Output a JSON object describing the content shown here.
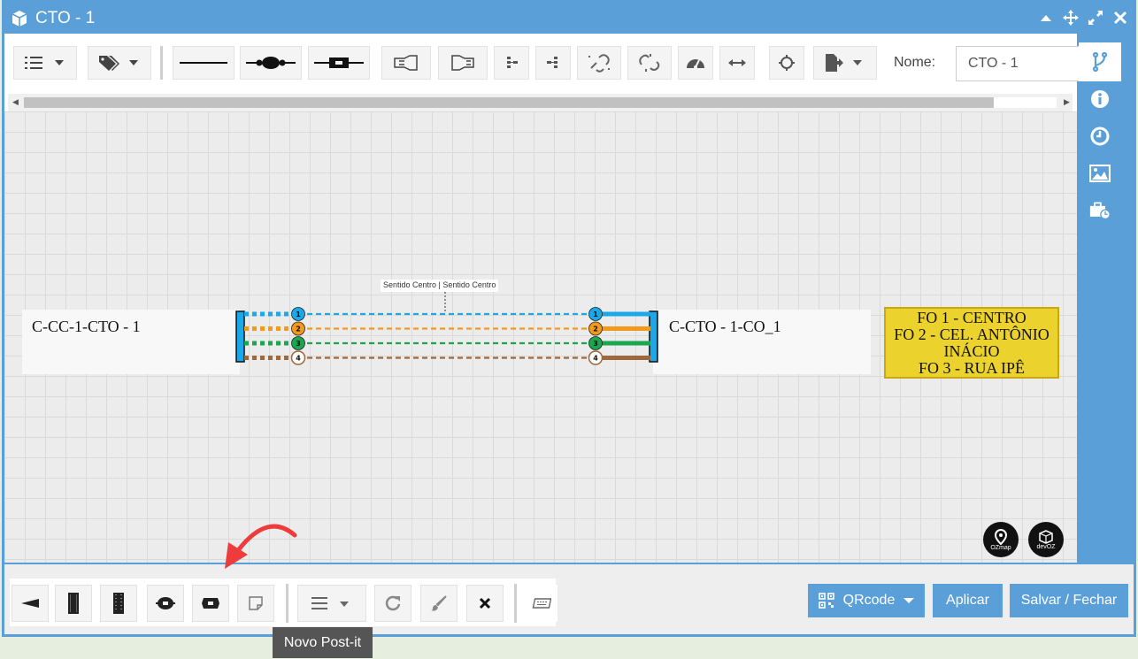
{
  "window": {
    "title": "CTO - 1"
  },
  "toolbar": {
    "nome_label": "Nome:",
    "nome_value": "CTO - 1"
  },
  "diagram": {
    "left_cable_label": "C-CC-1-CTO - 1",
    "right_cable_label": "C-CTO - 1-CO_1",
    "sentido_label": "Sentido Centro | Sentido Centro",
    "fibers": [
      {
        "number": "1",
        "color": "#1aa8e8"
      },
      {
        "number": "2",
        "color": "#f39a1a"
      },
      {
        "number": "3",
        "color": "#19a84f"
      },
      {
        "number": "4",
        "color": "#a0673a"
      }
    ],
    "postit_lines": [
      "FO 1 - CENTRO",
      "FO 2 - CEL. ANTÔNIO",
      "INÁCIO",
      "FO 3 - RUA IPÊ"
    ],
    "logos": [
      {
        "text": "OZmap"
      },
      {
        "text": "devOZ"
      }
    ]
  },
  "bottom": {
    "qrcode_label": "QRcode",
    "aplicar_label": "Aplicar",
    "salvar_label": "Salvar / Fechar"
  },
  "tooltip": {
    "text": "Novo Post-it"
  }
}
